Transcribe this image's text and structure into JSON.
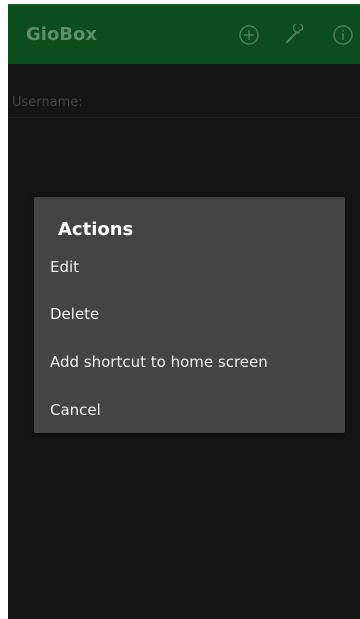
{
  "app": {
    "title": "GioBox",
    "icons": [
      "add-circle-icon",
      "wrench-icon",
      "info-icon"
    ],
    "colors": {
      "appbar": "#0b4d1b",
      "appbar_text": "#5f8f65",
      "background": "#141414",
      "dialog": "#444444"
    }
  },
  "form": {
    "username_label": "Username:"
  },
  "dialog": {
    "title": "Actions",
    "items": [
      {
        "label": "Edit"
      },
      {
        "label": "Delete"
      },
      {
        "label": "Add shortcut to home screen"
      },
      {
        "label": "Cancel"
      }
    ]
  }
}
